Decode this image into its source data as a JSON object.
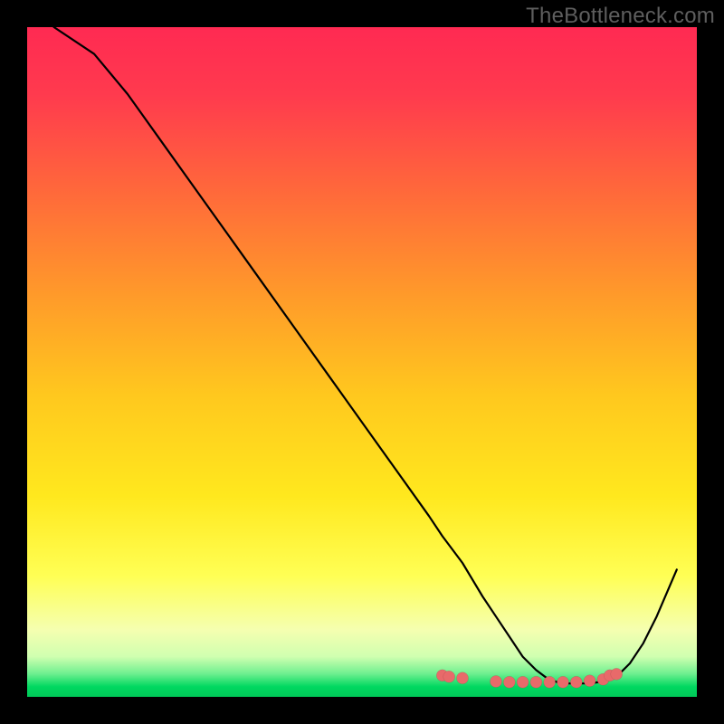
{
  "watermark": "TheBottleneck.com",
  "chart_data": {
    "type": "line",
    "title": "",
    "xlabel": "",
    "ylabel": "",
    "xlim": [
      0,
      100
    ],
    "ylim": [
      0,
      100
    ],
    "x": [
      4,
      10,
      15,
      20,
      25,
      30,
      35,
      40,
      45,
      50,
      55,
      60,
      62,
      65,
      68,
      70,
      72,
      74,
      76,
      78,
      80,
      82,
      84,
      86,
      88,
      90,
      92,
      94,
      97
    ],
    "values": [
      100,
      96,
      90,
      83,
      76,
      69,
      62,
      55,
      48,
      41,
      34,
      27,
      24,
      20,
      15,
      12,
      9,
      6,
      4,
      2.5,
      2,
      2,
      2,
      2.3,
      3,
      5,
      8,
      12,
      19
    ],
    "marker_points": {
      "x": [
        62,
        63,
        65,
        70,
        72,
        74,
        76,
        78,
        80,
        82,
        84,
        86,
        87,
        88
      ],
      "y": [
        3.2,
        3.0,
        2.8,
        2.3,
        2.2,
        2.2,
        2.2,
        2.2,
        2.2,
        2.2,
        2.4,
        2.6,
        3.2,
        3.4
      ]
    },
    "colors": {
      "gradient_top": "#ff2850",
      "gradient_mid": "#ffd000",
      "gradient_low": "#ffff70",
      "gradient_bottom": "#00d860",
      "line": "#000000",
      "marker": "#e86a6a"
    }
  }
}
